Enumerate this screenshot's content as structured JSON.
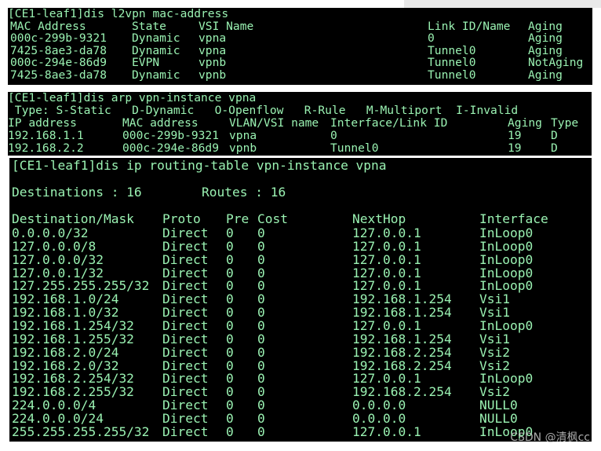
{
  "mac_table": {
    "command": "[CE1-leaf1]dis l2vpn mac-address",
    "headers": [
      "MAC Address",
      "State",
      "VSI Name",
      "Link ID/Name",
      "Aging"
    ],
    "rows": [
      [
        "000c-299b-9321",
        "Dynamic",
        "vpna",
        "0",
        "Aging"
      ],
      [
        "7425-8ae3-da78",
        "Dynamic",
        "vpna",
        "Tunnel0",
        "Aging"
      ],
      [
        "000c-294e-86d9",
        "EVPN",
        "vpnb",
        "Tunnel0",
        "NotAging"
      ],
      [
        "7425-8ae3-da78",
        "Dynamic",
        "vpnb",
        "Tunnel0",
        "Aging"
      ]
    ]
  },
  "arp_table": {
    "command": "[CE1-leaf1]dis arp vpn-instance vpna",
    "legend": " Type: S-Static   D-Dynamic   O-Openflow   R-Rule   M-Multiport  I-Invalid",
    "headers": [
      "IP address",
      "MAC address",
      "VLAN/VSI name",
      "Interface/Link ID",
      "Aging",
      "Type"
    ],
    "rows": [
      [
        "192.168.1.1",
        "000c-299b-9321",
        "vpna",
        "0",
        "19",
        "D"
      ],
      [
        "192.168.2.2",
        "000c-294e-86d9",
        "vpnb",
        "Tunnel0",
        "19",
        "D"
      ]
    ]
  },
  "route_table": {
    "command": "[CE1-leaf1]dis ip routing-table vpn-instance vpna",
    "destinations_label": "Destinations : 16",
    "routes_label": "Routes : 16",
    "headers": [
      "Destination/Mask",
      "Proto",
      "Pre",
      "Cost",
      "NextHop",
      "Interface"
    ],
    "rows": [
      [
        "0.0.0.0/32",
        "Direct",
        "0",
        "0",
        "127.0.0.1",
        "InLoop0"
      ],
      [
        "127.0.0.0/8",
        "Direct",
        "0",
        "0",
        "127.0.0.1",
        "InLoop0"
      ],
      [
        "127.0.0.0/32",
        "Direct",
        "0",
        "0",
        "127.0.0.1",
        "InLoop0"
      ],
      [
        "127.0.0.1/32",
        "Direct",
        "0",
        "0",
        "127.0.0.1",
        "InLoop0"
      ],
      [
        "127.255.255.255/32",
        "Direct",
        "0",
        "0",
        "127.0.0.1",
        "InLoop0"
      ],
      [
        "192.168.1.0/24",
        "Direct",
        "0",
        "0",
        "192.168.1.254",
        "Vsi1"
      ],
      [
        "192.168.1.0/32",
        "Direct",
        "0",
        "0",
        "192.168.1.254",
        "Vsi1"
      ],
      [
        "192.168.1.254/32",
        "Direct",
        "0",
        "0",
        "127.0.0.1",
        "InLoop0"
      ],
      [
        "192.168.1.255/32",
        "Direct",
        "0",
        "0",
        "192.168.1.254",
        "Vsi1"
      ],
      [
        "192.168.2.0/24",
        "Direct",
        "0",
        "0",
        "192.168.2.254",
        "Vsi2"
      ],
      [
        "192.168.2.0/32",
        "Direct",
        "0",
        "0",
        "192.168.2.254",
        "Vsi2"
      ],
      [
        "192.168.2.254/32",
        "Direct",
        "0",
        "0",
        "127.0.0.1",
        "InLoop0"
      ],
      [
        "192.168.2.255/32",
        "Direct",
        "0",
        "0",
        "192.168.2.254",
        "Vsi2"
      ],
      [
        "224.0.0.0/4",
        "Direct",
        "0",
        "0",
        "0.0.0.0",
        "NULL0"
      ],
      [
        "224.0.0.0/24",
        "Direct",
        "0",
        "0",
        "0.0.0.0",
        "NULL0"
      ],
      [
        "255.255.255.255/32",
        "Direct",
        "0",
        "0",
        "127.0.0.1",
        "InLoop0"
      ]
    ]
  },
  "watermark": "CSDN @清枫cc",
  "colors": {
    "terminal_bg": "#000000",
    "terminal_text": "#9af2b2"
  }
}
